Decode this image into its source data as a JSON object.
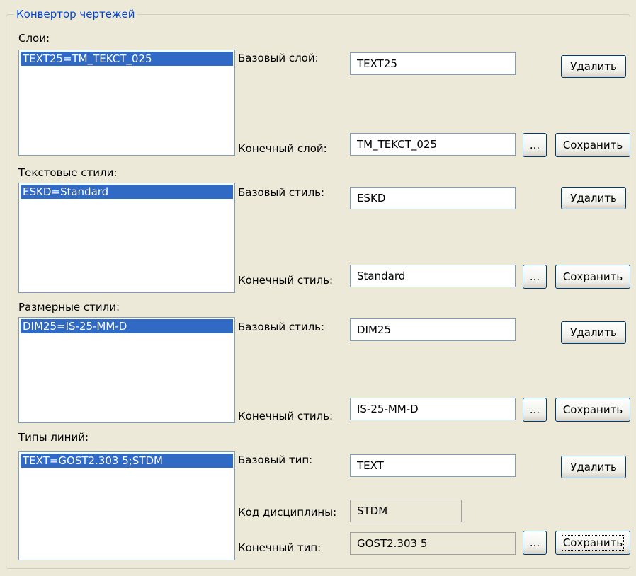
{
  "group_title": "Конвертор чертежей",
  "sections": [
    {
      "title": "Слои:",
      "list_item": "TEXT25=TM_TEKCT_025",
      "base_label": "Базовый слой:",
      "base_value": "TEXT25",
      "target_label": "Конечный слой:",
      "target_value": "TM_TEKCT_025",
      "delete_label": "Удалить",
      "browse_label": "...",
      "save_label": "Сохранить"
    },
    {
      "title": "Текстовые стили:",
      "list_item": "ESKD=Standard",
      "base_label": "Базовый стиль:",
      "base_value": "ESKD",
      "target_label": "Конечный стиль:",
      "target_value": "Standard",
      "delete_label": "Удалить",
      "browse_label": "...",
      "save_label": "Сохранить"
    },
    {
      "title": "Размерные стили:",
      "list_item": "DIM25=IS-25-MM-D",
      "base_label": "Базовый стиль:",
      "base_value": "DIM25",
      "target_label": "Конечный стиль:",
      "target_value": "IS-25-MM-D",
      "delete_label": "Удалить",
      "browse_label": "...",
      "save_label": "Сохранить"
    },
    {
      "title": "Типы линий:",
      "list_item": "TEXT=GOST2.303 5;STDM",
      "base_label": "Базовый тип:",
      "base_value": "TEXT",
      "discipline_label": "Код дисциплины:",
      "discipline_value": "STDM",
      "target_label": "Конечный тип:",
      "target_value": "GOST2.303 5",
      "delete_label": "Удалить",
      "browse_label": "...",
      "save_label": "Сохранить"
    }
  ],
  "colors": {
    "selection": "#316ac5",
    "group_title": "#0046d5",
    "background": "#ece9d8"
  }
}
